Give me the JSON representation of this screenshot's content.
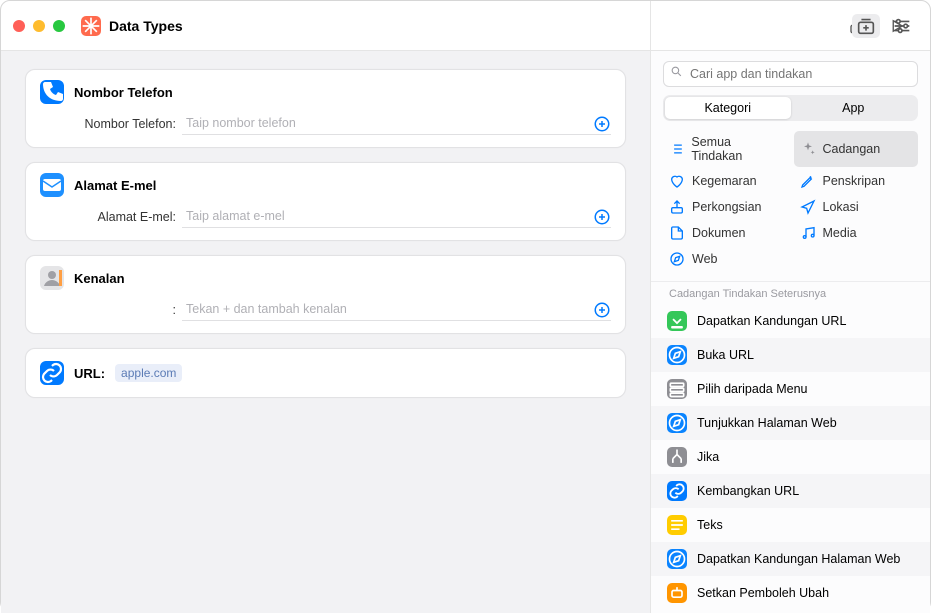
{
  "window": {
    "title": "Data Types"
  },
  "cards": {
    "phone": {
      "title": "Nombor Telefon",
      "label": "Nombor Telefon:",
      "placeholder": "Taip nombor telefon"
    },
    "email": {
      "title": "Alamat E-mel",
      "label": "Alamat E-mel:",
      "placeholder": "Taip alamat e-mel"
    },
    "contact": {
      "title": "Kenalan",
      "label": ":",
      "placeholder": "Tekan + dan tambah kenalan"
    },
    "url": {
      "label": "URL:",
      "value": "apple.com"
    }
  },
  "sidebar": {
    "search_placeholder": "Cari app dan tindakan",
    "seg": {
      "left": "Kategori",
      "right": "App"
    },
    "categories": [
      {
        "label": "Semua Tindakan",
        "icon": "list",
        "color": "#007aff"
      },
      {
        "label": "Cadangan",
        "icon": "sparkle",
        "color": "#8e8e93",
        "selected": true
      },
      {
        "label": "Kegemaran",
        "icon": "heart",
        "color": "#007aff"
      },
      {
        "label": "Penskripan",
        "icon": "pencil",
        "color": "#007aff"
      },
      {
        "label": "Perkongsian",
        "icon": "share",
        "color": "#007aff"
      },
      {
        "label": "Lokasi",
        "icon": "arrow",
        "color": "#007aff"
      },
      {
        "label": "Dokumen",
        "icon": "doc",
        "color": "#007aff"
      },
      {
        "label": "Media",
        "icon": "music",
        "color": "#007aff"
      },
      {
        "label": "Web",
        "icon": "safari",
        "color": "#007aff"
      }
    ],
    "suggestions_header": "Cadangan Tindakan Seterusnya",
    "actions": [
      {
        "label": "Dapatkan Kandungan URL",
        "bg": "#34c759",
        "glyph": "download"
      },
      {
        "label": "Buka URL",
        "bg": "#0a84ff",
        "glyph": "safari"
      },
      {
        "label": "Pilih daripada Menu",
        "bg": "#8e8e93",
        "glyph": "menu"
      },
      {
        "label": "Tunjukkan Halaman Web",
        "bg": "#0a84ff",
        "glyph": "safari"
      },
      {
        "label": "Jika",
        "bg": "#8e8e93",
        "glyph": "branch"
      },
      {
        "label": "Kembangkan URL",
        "bg": "#007aff",
        "glyph": "link"
      },
      {
        "label": "Teks",
        "bg": "#ffcc00",
        "glyph": "text"
      },
      {
        "label": "Dapatkan Kandungan Halaman Web",
        "bg": "#0a84ff",
        "glyph": "safari"
      },
      {
        "label": "Setkan Pemboleh Ubah",
        "bg": "#ff9500",
        "glyph": "var"
      }
    ]
  }
}
